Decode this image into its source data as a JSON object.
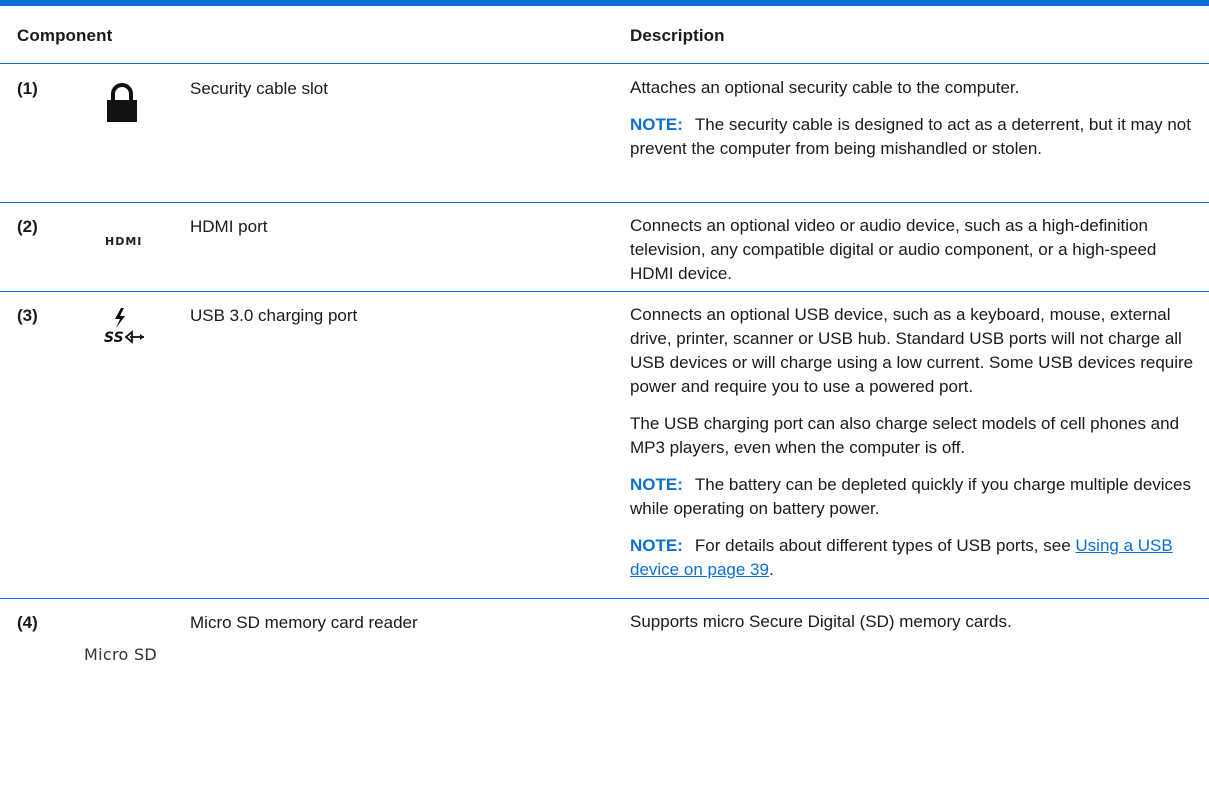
{
  "table": {
    "headers": {
      "component": "Component",
      "description": "Description"
    },
    "rows": [
      {
        "number": "(1)",
        "icon": "lock-icon",
        "name": "Security cable slot",
        "description": [
          "Attaches an optional security cable to the computer."
        ],
        "notes": [
          {
            "label": "NOTE:",
            "text": "The security cable is designed to act as a deterrent, but it may not prevent the computer from being mishandled or stolen."
          }
        ]
      },
      {
        "number": "(2)",
        "icon": "hdmi-icon",
        "icon_text": "HDMI",
        "name": "HDMI port",
        "description": [
          "Connects an optional video or audio device, such as a high-definition television, any compatible digital or audio component, or a high-speed HDMI device."
        ],
        "notes": []
      },
      {
        "number": "(3)",
        "icon": "usb-charging-icon",
        "icon_text": "SS",
        "name": "USB 3.0 charging port",
        "description": [
          "Connects an optional USB device, such as a keyboard, mouse, external drive, printer, scanner or USB hub. Standard USB ports will not charge all USB devices or will charge using a low current. Some USB devices require power and require you to use a powered port.",
          "The USB charging port can also charge select models of cell phones and MP3 players, even when the computer is off."
        ],
        "notes": [
          {
            "label": "NOTE:",
            "text": "The battery can be depleted quickly if you charge multiple devices while operating on battery power."
          },
          {
            "label": "NOTE:",
            "text": "For details about different types of USB ports, see",
            "link": "Using a USB device on page 39",
            "suffix": "."
          }
        ]
      },
      {
        "number": "(4)",
        "icon": "micro-sd-icon",
        "icon_text": "Micro SD",
        "name": "Micro SD memory card reader",
        "description": [
          "Supports micro Secure Digital (SD) memory cards."
        ],
        "notes": []
      }
    ]
  },
  "colors": {
    "accent": "#0b6fd6",
    "text": "#1a1a1a"
  }
}
